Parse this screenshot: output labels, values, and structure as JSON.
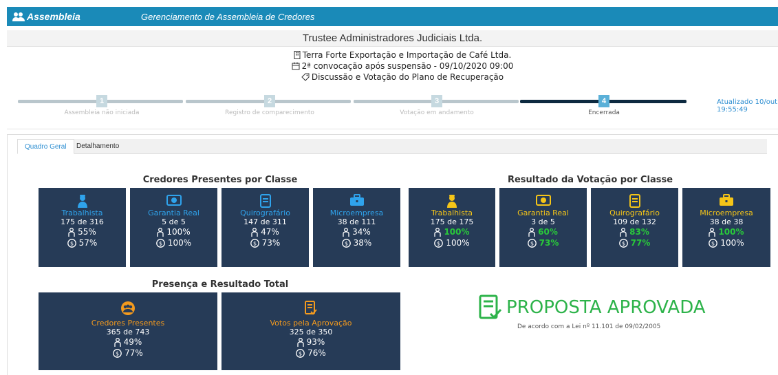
{
  "app": {
    "brand": "Assembleia",
    "subtitle": "Gerenciamento de Assembleia de Credores"
  },
  "company": "Trustee Administradores Judiciais Ltda.",
  "info": {
    "debtor": "Terra Forte Exportação e Importação de Café Ltda.",
    "convocation": "2ª convocação após suspensão - 09/10/2020 09:00",
    "topic": "Discussão e Votação do Plano de Recuperação"
  },
  "steps": [
    {
      "number": "1",
      "label": "Assembleia não iniciada",
      "state": "done"
    },
    {
      "number": "2",
      "label": "Registro de comparecimento",
      "state": "done"
    },
    {
      "number": "3",
      "label": "Votação em andamento",
      "state": "done"
    },
    {
      "number": "4",
      "label": "Encerrada",
      "state": "active"
    }
  ],
  "updated": {
    "line1": "Atualizado 10/out",
    "line2": "19:55:49"
  },
  "tabs": {
    "overview": "Quadro Geral",
    "details": "Detalhamento"
  },
  "presence": {
    "title": "Credores Presentes por Classe",
    "cards": [
      {
        "name": "Trabalhista",
        "count": "175 de 316",
        "heads": "55%",
        "value": "57%"
      },
      {
        "name": "Garantia Real",
        "count": "5 de 5",
        "heads": "100%",
        "value": "100%"
      },
      {
        "name": "Quirografário",
        "count": "147 de 311",
        "heads": "47%",
        "value": "73%"
      },
      {
        "name": "Microempresa",
        "count": "38 de 111",
        "heads": "34%",
        "value": "38%"
      }
    ]
  },
  "voting": {
    "title": "Resultado da Votação por Classe",
    "cards": [
      {
        "name": "Trabalhista",
        "count": "175 de 175",
        "heads": "100%",
        "value": "100%"
      },
      {
        "name": "Garantia Real",
        "count": "3 de 5",
        "heads": "60%",
        "value": "73%"
      },
      {
        "name": "Quirografário",
        "count": "109 de 132",
        "heads": "83%",
        "value": "77%"
      },
      {
        "name": "Microempresa",
        "count": "38 de 38",
        "heads": "100%",
        "value": "100%"
      }
    ]
  },
  "total": {
    "title": "Presença e Resultado Total",
    "present": {
      "name": "Credores Presentes",
      "count": "365 de 743",
      "heads": "49%",
      "value": "77%"
    },
    "approval": {
      "name": "Votos pela Aprovação",
      "count": "325 de 350",
      "heads": "93%",
      "value": "76%"
    }
  },
  "result": {
    "status": "PROPOSTA APROVADA",
    "law": "De acordo com a Lei nº 11.101 de 09/02/2005"
  },
  "colors": {
    "header": "#1a8ab8",
    "card": "#263b57",
    "blue": "#2fa3ec",
    "yellow": "#f5c518",
    "orange": "#f39a1e",
    "green": "#29c93a",
    "approved": "#2db34a"
  }
}
